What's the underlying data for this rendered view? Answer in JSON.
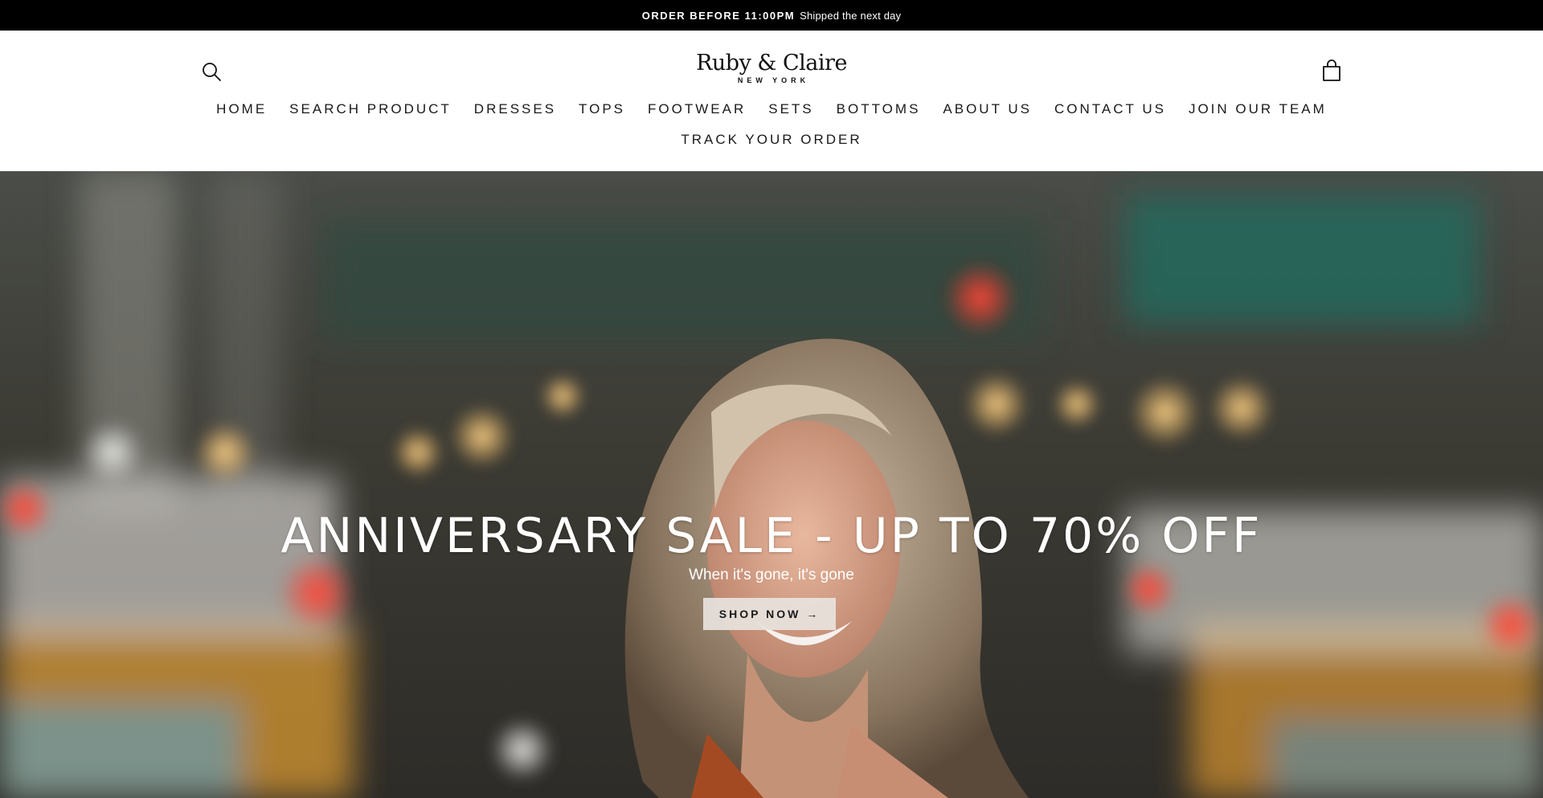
{
  "announcement": {
    "strong": "ORDER BEFORE 11:00PM",
    "light": "Shipped the next day"
  },
  "header": {
    "logo_main": "Ruby & Claire",
    "logo_sub": "NEW YORK",
    "search_icon": "search-icon",
    "cart_icon": "shopping-bag-icon"
  },
  "nav": {
    "row1": [
      {
        "label": "HOME"
      },
      {
        "label": "SEARCH PRODUCT"
      },
      {
        "label": "DRESSES"
      },
      {
        "label": "TOPS"
      },
      {
        "label": "FOOTWEAR"
      },
      {
        "label": "SETS"
      },
      {
        "label": "BOTTOMS"
      },
      {
        "label": "ABOUT US"
      },
      {
        "label": "CONTACT US"
      },
      {
        "label": "JOIN OUR TEAM"
      }
    ],
    "row2": [
      {
        "label": "TRACK YOUR ORDER"
      }
    ]
  },
  "hero": {
    "title": "ANNIVERSARY SALE - UP TO 70% OFF",
    "subtitle": "When it's gone, it's gone",
    "button": "SHOP NOW →"
  },
  "colors": {
    "announcement_bg": "#000000",
    "header_bg": "#ffffff",
    "text": "#1a1a1a",
    "hero_button_bg": "#e8e3de"
  }
}
